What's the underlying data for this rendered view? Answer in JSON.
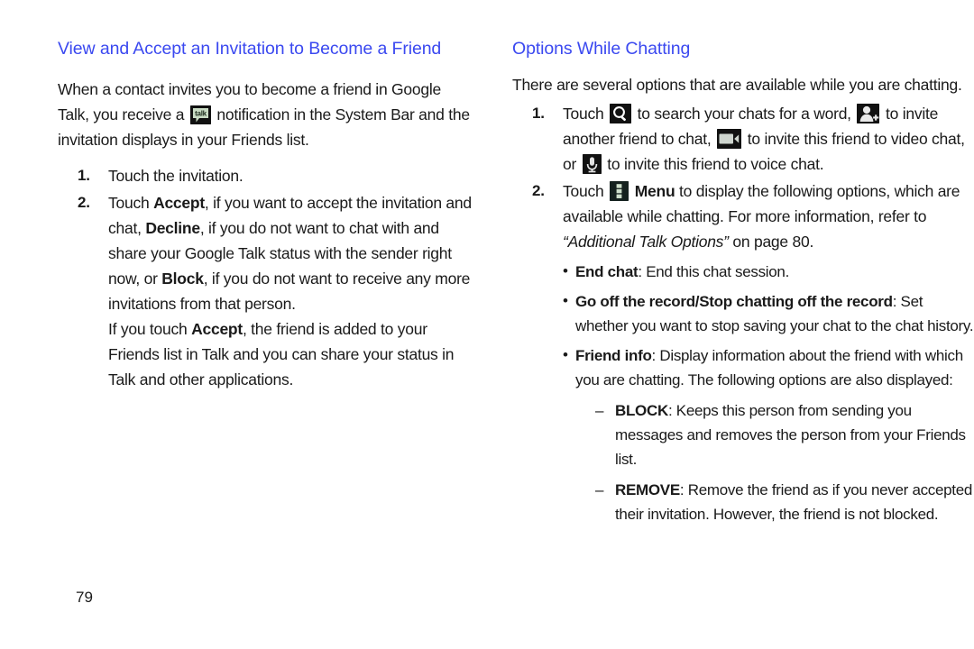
{
  "page": {
    "number": "79",
    "heading_color": "#3b49f0",
    "text_color": "#1a1a1a",
    "background": "#ffffff"
  },
  "left_column": {
    "heading": "View and Accept an Invitation to Become a Friend",
    "intro_1": "When a contact invites you to become a friend in Google Talk, you receive a ",
    "intro_icon": "talk-notification-icon",
    "intro_2": " notification in the System Bar and the invitation displays in your Friends list.",
    "steps": [
      {
        "num": "1.",
        "text": "Touch the invitation."
      },
      {
        "num": "2.",
        "t1": "Touch ",
        "b1": "Accept",
        "t2": ", if you want to accept the invitation and chat, ",
        "b2": "Decline",
        "t3": ", if you do not want to chat with and share your Google Talk status with the sender right now, or ",
        "b3": "Block",
        "t4": ", if you do not want to receive any more invitations from that person.",
        "sub_t1": "If you touch ",
        "sub_b1": "Accept",
        "sub_t2": ", the friend is added to your Friends list in Talk and you can share your status in Talk and other applications."
      }
    ]
  },
  "right_column": {
    "heading": "Options While Chatting",
    "intro": "There are several options that are available while you are chatting.",
    "steps": [
      {
        "num": "1.",
        "t1": "Touch ",
        "icon1": "search-icon",
        "t2": " to search your chats for a word, ",
        "icon2": "add-friend-icon",
        "t3": " to invite another friend to chat, ",
        "icon3": "video-camera-icon",
        "t4": " to invite this friend to video chat, or ",
        "icon4": "microphone-icon",
        "t5": " to invite this friend to voice chat."
      },
      {
        "num": "2.",
        "t1": "Touch ",
        "icon1": "menu-icon",
        "b1": "Menu",
        "t2": " to display the following options, which are available while chatting. For more information, refer to ",
        "i1": "“Additional Talk Options”",
        "t3": " on page 80."
      }
    ],
    "bullets": [
      {
        "label": "End chat",
        "text": ": End this chat session."
      },
      {
        "label": "Go off the record/Stop chatting off the record",
        "text": ": Set whether you want to stop saving your chat to the chat history."
      },
      {
        "label": "Friend info",
        "text": ": Display information about the friend with which you are chatting. The following options are also displayed:"
      }
    ],
    "subitems": [
      {
        "label": "BLOCK",
        "text": ": Keeps this person from sending you messages and removes the person from your Friends list."
      },
      {
        "label": "REMOVE",
        "text": ": Remove the friend as if you never accepted their invitation. However, the friend is not blocked."
      }
    ]
  }
}
